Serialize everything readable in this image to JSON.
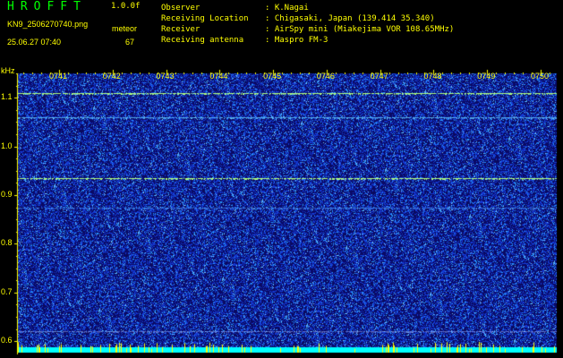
{
  "header": {
    "app_title": "HROFFT",
    "version": "1.0.0f",
    "file_name": "KN9_2506270740.png",
    "meteor_label": "meteor",
    "datetime": "25.06.27 07:40",
    "meteor_count": "67"
  },
  "info": [
    {
      "label": "Observer",
      "value": ": K.Nagai"
    },
    {
      "label": "Receiving Location",
      "value": ": Chigasaki, Japan (139.414 35.340)"
    },
    {
      "label": "Receiver",
      "value": ": AirSpy mini (Miakejima VOR 108.65MHz)"
    },
    {
      "label": "Receiving antenna",
      "value": ": Maspro FM-3"
    }
  ],
  "chart_data": {
    "type": "heatmap",
    "ylabel": "kHz",
    "yticks": [
      "1.1",
      "1.0",
      "0.9",
      "0.8",
      "0.7",
      "0.6"
    ],
    "ylim": [
      0.58,
      1.15
    ],
    "xticks": [
      "0741",
      "0742",
      "0743",
      "0744",
      "0745",
      "0746",
      "0747",
      "0748",
      "0749",
      "0750"
    ],
    "lines": [
      {
        "freq": 1.11,
        "color": "#b0ff80",
        "intensity": 1.0
      },
      {
        "freq": 1.06,
        "color": "#60c8ff",
        "intensity": 0.8
      },
      {
        "freq": 0.935,
        "color": "#b0ff80",
        "intensity": 1.0
      },
      {
        "freq": 0.875,
        "color": "#50a0ff",
        "intensity": 0.6
      },
      {
        "freq": 0.62,
        "color": "#a0b8ff",
        "intensity": 0.5
      }
    ],
    "colors": {
      "background": "#0a0a6a",
      "noise_dot": "#3040ff",
      "axis": "#ffff00",
      "bottom_band": "#00ffff"
    }
  }
}
